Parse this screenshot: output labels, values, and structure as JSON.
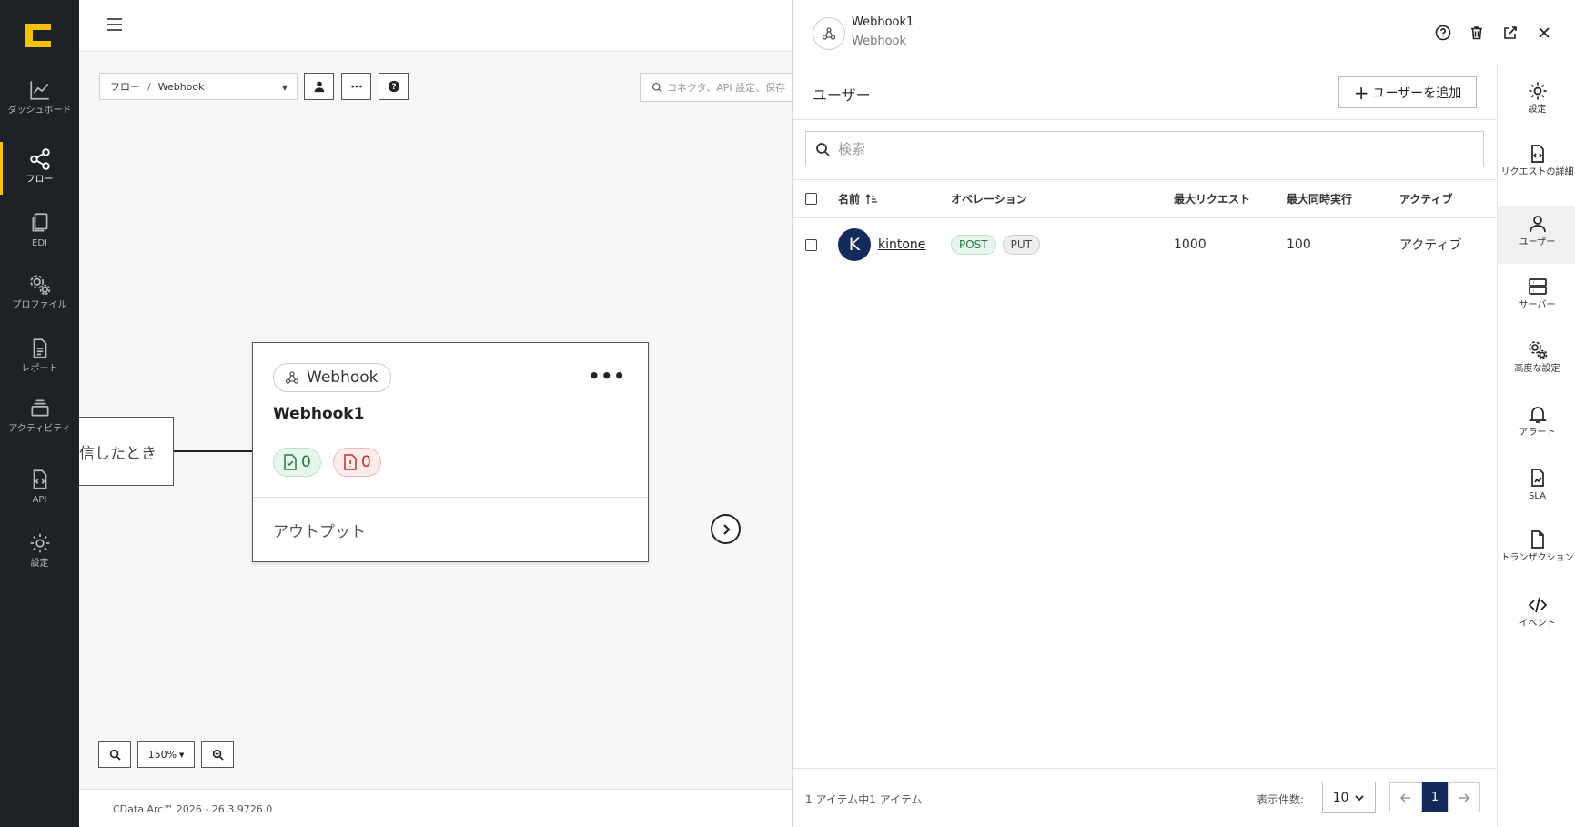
{
  "nav": {
    "items": [
      {
        "label": "ダッシュボード",
        "icon": "chart-line-icon"
      },
      {
        "label": "フロー",
        "icon": "share-nodes-icon",
        "active": true
      },
      {
        "label": "EDI",
        "icon": "documents-icon"
      },
      {
        "label": "プロファイル",
        "icon": "gears-icon"
      },
      {
        "label": "レポート",
        "icon": "report-icon"
      },
      {
        "label": "アクティビティ",
        "icon": "activity-icon"
      },
      {
        "label": "API",
        "icon": "api-icon"
      },
      {
        "label": "設定",
        "icon": "gear-icon"
      }
    ]
  },
  "canvas": {
    "breadcrumb": {
      "root": "フロー",
      "sep": "/",
      "current": "Webhook"
    },
    "search_placeholder": "コネクタ、API 設定、保存",
    "trigger_node_text": "信したとき",
    "webhook_node": {
      "type_label": "Webhook",
      "name": "Webhook1",
      "success_count": "0",
      "error_count": "0",
      "output_label": "アウトプット"
    },
    "zoom_level": "150%",
    "version": "CData Arc™ 2026 - 26.3.9726.0"
  },
  "panel": {
    "title": "Webhook1",
    "subtitle": "Webhook",
    "section_title": "ユーザー",
    "add_user_label": "ユーザーを追加",
    "search_placeholder": "検索",
    "columns": {
      "name": "名前",
      "operation": "オペレーション",
      "max_requests": "最大リクエスト",
      "max_concurrent": "最大同時実行",
      "active": "アクティブ"
    },
    "rows": [
      {
        "initial": "K",
        "name": "kintone",
        "operations": [
          "POST",
          "PUT"
        ],
        "max_requests": "1000",
        "max_concurrent": "100",
        "active": "アクティブ"
      }
    ],
    "footer": {
      "count_text": "1 アイテム中1 アイテム",
      "per_page_label": "表示件数:",
      "per_page": "10",
      "current_page": "1"
    }
  },
  "rail": {
    "items": [
      {
        "label": "設定"
      },
      {
        "label": "リクエストの詳細"
      },
      {
        "label": "ユーザー",
        "active": true
      },
      {
        "label": "サーバー"
      },
      {
        "label": "高度な設定"
      },
      {
        "label": "アラート"
      },
      {
        "label": "SLA"
      },
      {
        "label": "トランザクション"
      },
      {
        "label": "イベント"
      }
    ]
  },
  "colors": {
    "nav_bg": "#1e2126",
    "accent": "#f4c20d",
    "primary": "#142a5c",
    "success": "#1e7a3c",
    "error": "#c62828"
  }
}
